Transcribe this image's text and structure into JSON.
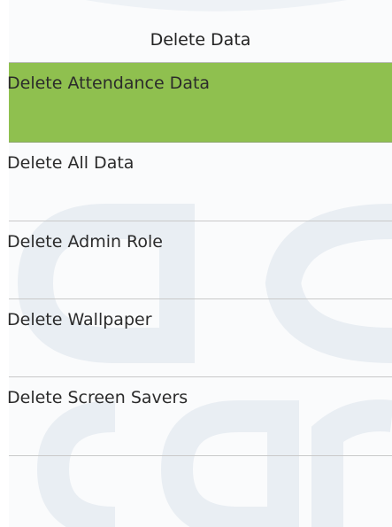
{
  "header": {
    "title": "Delete Data"
  },
  "menu": {
    "items": [
      {
        "label": "Delete Attendance Data",
        "selected": true
      },
      {
        "label": "Delete All Data",
        "selected": false
      },
      {
        "label": "Delete Admin Role",
        "selected": false
      },
      {
        "label": "Delete Wallpaper",
        "selected": false
      },
      {
        "label": "Delete Screen Savers",
        "selected": false
      }
    ]
  },
  "colors": {
    "selected_background": "#8fc04f",
    "watermark": "#e8eef4"
  }
}
